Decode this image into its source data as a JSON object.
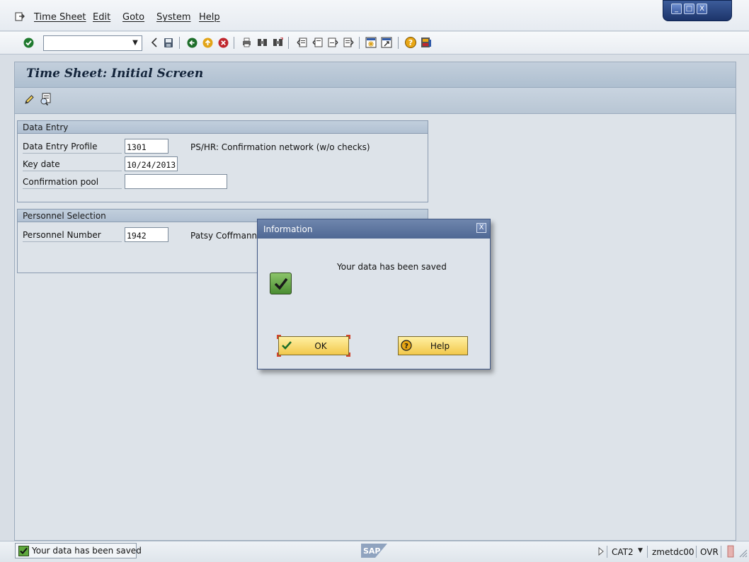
{
  "menu": {
    "items": [
      "Time Sheet",
      "Edit",
      "Goto",
      "System",
      "Help"
    ]
  },
  "window_controls": {
    "minimize": "_",
    "maximize": "□",
    "close": "X"
  },
  "toolbar": {
    "command_field_value": "",
    "icons": [
      "enter-icon",
      "back-icon",
      "save-icon",
      "back-green-icon",
      "exit-icon",
      "cancel-icon",
      "print-icon",
      "find-icon",
      "find-next-icon",
      "first-page-icon",
      "previous-page-icon",
      "next-page-icon",
      "last-page-icon",
      "create-session-icon",
      "shortcut-icon",
      "help-icon",
      "customize-layout-icon"
    ]
  },
  "page": {
    "title": "Time Sheet: Initial Screen"
  },
  "app_toolbar": {
    "icons": [
      "change-pencil-icon",
      "display-icon"
    ]
  },
  "data_entry": {
    "header": "Data Entry",
    "profile_label": "Data Entry Profile",
    "profile_value": "1301",
    "profile_desc": "PS/HR: Confirmation network (w/o checks)",
    "key_date_label": "Key date",
    "key_date_value": "10/24/2013",
    "pool_label": "Confirmation pool",
    "pool_value": ""
  },
  "personnel": {
    "header": "Personnel Selection",
    "number_label": "Personnel Number",
    "number_value": "1942",
    "name": "Patsy Coffmann"
  },
  "dialog": {
    "title": "Information",
    "close": "X",
    "message": "Your data has been saved",
    "ok_label": "OK",
    "help_label": "Help"
  },
  "status": {
    "message": "Your data has been saved",
    "logo": "SAP",
    "transaction": "CAT2",
    "server": "zmetdc00",
    "mode": "OVR"
  },
  "colors": {
    "accent": "#4f6894",
    "button_yellow": "#f2c84b",
    "success_green": "#4b8d32"
  }
}
